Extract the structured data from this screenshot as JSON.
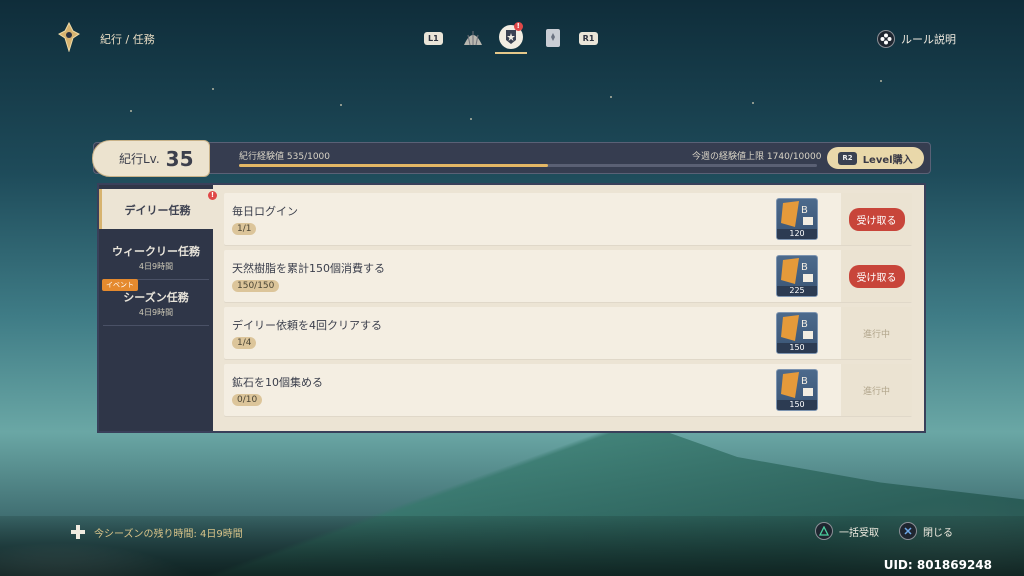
{
  "header": {
    "breadcrumb": "紀行 / 任務",
    "left_key": "L1",
    "right_key": "R1",
    "tab_alert": "!",
    "rules_label": "ルール説明"
  },
  "level": {
    "label": "紀行Lv.",
    "value": "35",
    "exp_label": "紀行経験値",
    "exp_text": "535/1000",
    "exp_fraction": 0.535,
    "weekly_label": "今週の経験値上限",
    "weekly_text": "1740/10000",
    "buy_key": "R2",
    "buy_label": "Level購入"
  },
  "sidebar": {
    "daily": {
      "label": "デイリー任務",
      "alert": "!"
    },
    "weekly": {
      "label": "ウィークリー任務",
      "time": "4日9時間"
    },
    "season": {
      "tag": "イベント",
      "label": "シーズン任務",
      "time": "4日9時間"
    }
  },
  "missions": [
    {
      "title": "毎日ログイン",
      "progress": "1/1",
      "reward": "120",
      "action": "受け取る",
      "claimable": true
    },
    {
      "title": "天然樹脂を累計150個消費する",
      "progress": "150/150",
      "reward": "225",
      "action": "受け取る",
      "claimable": true
    },
    {
      "title": "デイリー依頼を4回クリアする",
      "progress": "1/4",
      "reward": "150",
      "action": "進行中",
      "claimable": false
    },
    {
      "title": "鉱石を10個集める",
      "progress": "0/10",
      "reward": "150",
      "action": "進行中",
      "claimable": false
    }
  ],
  "footer": {
    "season_remaining": "今シーズンの残り時間: 4日9時間",
    "claim_all": "一括受取",
    "close": "閉じる",
    "uid": "UID: 801869248"
  },
  "colors": {
    "accent_gold": "#e3b765",
    "claim_red": "#c8453a",
    "panel_dark": "#2f3648",
    "panel_light": "#ece4d4"
  }
}
